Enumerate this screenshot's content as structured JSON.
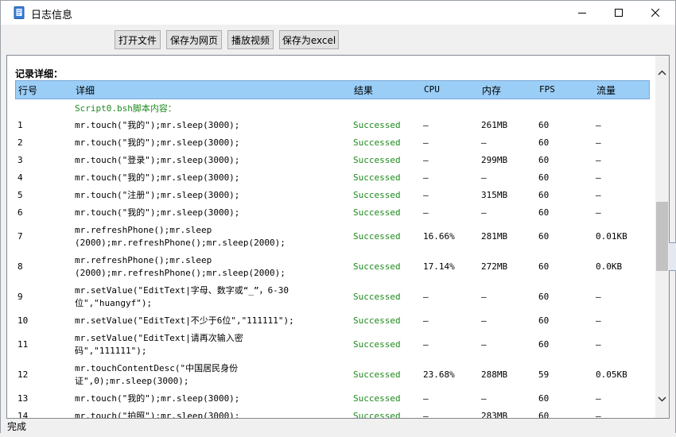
{
  "window": {
    "title": "日志信息"
  },
  "toolbar": {
    "open_file": "打开文件",
    "save_web": "保存为网页",
    "play_video": "播放视频",
    "save_excel": "保存为excel"
  },
  "log": {
    "section_label": "记录详细：",
    "headers": {
      "row": "行号",
      "detail": "详细",
      "result": "结果",
      "cpu": "CPU",
      "memory": "内存",
      "fps": "FPS",
      "traffic": "流量"
    },
    "script_title": "Script0.bsh脚本内容：",
    "rows": [
      {
        "no": "1",
        "detail": "mr.touch(\"我的\");mr.sleep(3000);",
        "result": "Successed",
        "cpu": "–",
        "memory": "261MB",
        "fps": "60",
        "traffic": "–"
      },
      {
        "no": "2",
        "detail": "mr.touch(\"我的\");mr.sleep(3000);",
        "result": "Successed",
        "cpu": "–",
        "memory": "–",
        "fps": "60",
        "traffic": "–"
      },
      {
        "no": "3",
        "detail": "mr.touch(\"登录\");mr.sleep(3000);",
        "result": "Successed",
        "cpu": "–",
        "memory": "299MB",
        "fps": "60",
        "traffic": "–"
      },
      {
        "no": "4",
        "detail": "mr.touch(\"我的\");mr.sleep(3000);",
        "result": "Successed",
        "cpu": "–",
        "memory": "–",
        "fps": "60",
        "traffic": "–"
      },
      {
        "no": "5",
        "detail": "mr.touch(\"注册\");mr.sleep(3000);",
        "result": "Successed",
        "cpu": "–",
        "memory": "315MB",
        "fps": "60",
        "traffic": "–"
      },
      {
        "no": "6",
        "detail": "mr.touch(\"我的\");mr.sleep(3000);",
        "result": "Successed",
        "cpu": "–",
        "memory": "–",
        "fps": "60",
        "traffic": "–"
      },
      {
        "no": "7",
        "detail": "mr.refreshPhone();mr.sleep\n(2000);mr.refreshPhone();mr.sleep(2000);",
        "result": "Successed",
        "cpu": "16.66%",
        "memory": "281MB",
        "fps": "60",
        "traffic": "0.01KB"
      },
      {
        "no": "8",
        "detail": "mr.refreshPhone();mr.sleep\n(2000);mr.refreshPhone();mr.sleep(2000);",
        "result": "Successed",
        "cpu": "17.14%",
        "memory": "272MB",
        "fps": "60",
        "traffic": "0.0KB"
      },
      {
        "no": "9",
        "detail": "mr.setValue(\"EditText|字母、数字或“_”，6-30\n位\",\"huangyf\");",
        "result": "Successed",
        "cpu": "–",
        "memory": "–",
        "fps": "60",
        "traffic": "–"
      },
      {
        "no": "10",
        "detail": "mr.setValue(\"EditText|不少于6位\",\"111111\");",
        "result": "Successed",
        "cpu": "–",
        "memory": "–",
        "fps": "60",
        "traffic": "–"
      },
      {
        "no": "11",
        "detail": "mr.setValue(\"EditText|请再次输入密\n码\",\"111111\");",
        "result": "Successed",
        "cpu": "–",
        "memory": "–",
        "fps": "60",
        "traffic": "–"
      },
      {
        "no": "12",
        "detail": "mr.touchContentDesc(\"中国居民身份\n证\",0);mr.sleep(3000);",
        "result": "Successed",
        "cpu": "23.68%",
        "memory": "288MB",
        "fps": "59",
        "traffic": "0.05KB"
      },
      {
        "no": "13",
        "detail": "mr.touch(\"我的\");mr.sleep(3000);",
        "result": "Successed",
        "cpu": "–",
        "memory": "–",
        "fps": "60",
        "traffic": "–"
      },
      {
        "no": "14",
        "detail": "mr.touch(\"拍照\");mr.sleep(3000);",
        "result": "Successed",
        "cpu": "–",
        "memory": "283MB",
        "fps": "60",
        "traffic": "–"
      }
    ]
  },
  "statusbar": {
    "text": "完成"
  }
}
